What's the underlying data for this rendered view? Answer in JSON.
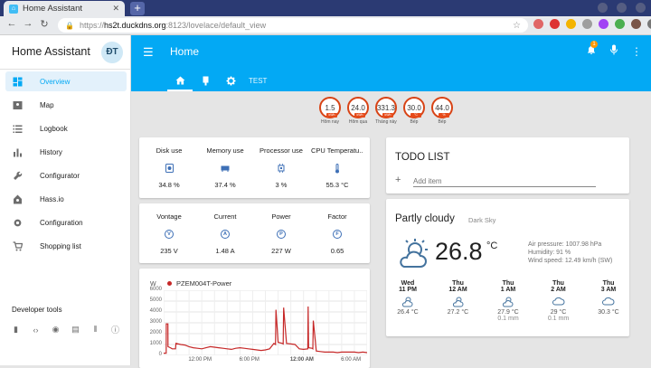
{
  "browser": {
    "tab_title": "Home Assistant",
    "url_scheme": "https://",
    "url_host": "hs2t.duckdns.org",
    "url_path": ":8123/lovelace/default_view"
  },
  "sidebar": {
    "title": "Home Assistant",
    "avatar": "ĐT",
    "items": [
      {
        "label": "Overview",
        "icon": "view-dashboard-icon",
        "active": true
      },
      {
        "label": "Map",
        "icon": "map-icon"
      },
      {
        "label": "Logbook",
        "icon": "list-icon"
      },
      {
        "label": "History",
        "icon": "chart-bar-icon"
      },
      {
        "label": "Configurator",
        "icon": "wrench-icon"
      },
      {
        "label": "Hass.io",
        "icon": "hassio-icon"
      },
      {
        "label": "Configuration",
        "icon": "gear-icon"
      },
      {
        "label": "Shopping list",
        "icon": "cart-icon"
      }
    ],
    "dev_tools_label": "Developer tools"
  },
  "header": {
    "title": "Home",
    "notification_count": "1",
    "tab_text": "TEST",
    "accent": "#03a9f4"
  },
  "gauges": [
    {
      "value": "1.5",
      "unit": "kWh",
      "label": "Hôm nay"
    },
    {
      "value": "24.0",
      "unit": "kWh",
      "label": "Hôm qua"
    },
    {
      "value": "331.3",
      "unit": "kWh",
      "label": "Tháng này"
    },
    {
      "value": "30.0",
      "unit": "°C",
      "label": "Bếp"
    },
    {
      "value": "44.0",
      "unit": "%",
      "label": "Bếp"
    }
  ],
  "system_stats": [
    {
      "name": "Disk use",
      "value": "34.8 %"
    },
    {
      "name": "Memory use",
      "value": "37.4 %"
    },
    {
      "name": "Processor use",
      "value": "3 %"
    },
    {
      "name": "CPU Temperatu...",
      "value": "55.3 °C"
    }
  ],
  "power_stats": [
    {
      "name": "Vontage",
      "letter": "V",
      "value": "235 V"
    },
    {
      "name": "Current",
      "letter": "A",
      "value": "1.48 A"
    },
    {
      "name": "Power",
      "letter": "P",
      "value": "227 W"
    },
    {
      "name": "Factor",
      "letter": "F",
      "value": "0.65"
    }
  ],
  "todo": {
    "title": "TODO LIST",
    "placeholder": "Add item"
  },
  "weather": {
    "condition": "Partly cloudy",
    "source": "Dark Sky",
    "temperature": "26.8",
    "unit": "°C",
    "pressure": "Air pressure: 1007.98 hPa",
    "humidity": "Humidity: 91 %",
    "wind": "Wind speed: 12.49 km/h (SW)",
    "forecast": [
      {
        "day": "Wed",
        "time": "11 PM",
        "temp": "26.4 °C",
        "precip": "",
        "icon": "partly-cloudy-icon"
      },
      {
        "day": "Thu",
        "time": "12 AM",
        "temp": "27.2 °C",
        "precip": "",
        "icon": "partly-cloudy-icon"
      },
      {
        "day": "Thu",
        "time": "1 AM",
        "temp": "27.9 °C",
        "precip": "0.1 mm",
        "icon": "partly-cloudy-icon"
      },
      {
        "day": "Thu",
        "time": "2 AM",
        "temp": "29 °C",
        "precip": "0.1 mm",
        "icon": "cloudy-icon"
      },
      {
        "day": "Thu",
        "time": "3 AM",
        "temp": "30.3 °C",
        "precip": "",
        "icon": "cloudy-icon"
      }
    ]
  },
  "chart_data": {
    "type": "line",
    "title": "",
    "ylabel": "W",
    "series": [
      {
        "name": "PZEM004T-Power",
        "color": "#c62828",
        "x": [
          0,
          0.3,
          0.31,
          0.5,
          0.51,
          0.8,
          1.0,
          1.4,
          1.45,
          2,
          2.5,
          3,
          3.5,
          4,
          4.5,
          5,
          5.5,
          6,
          6.5,
          7,
          7.5,
          8,
          8.5,
          9,
          9.5,
          10,
          10.5,
          11,
          11.5,
          12,
          12.5,
          13,
          13.2,
          13.25,
          13.5,
          14,
          14.1,
          14.15,
          14.5,
          15,
          15.5,
          16,
          16.5,
          17,
          17.05,
          17.1,
          17.5,
          17.6,
          17.65,
          18,
          18.5,
          19,
          19.5,
          20,
          20.5,
          21,
          21.5,
          22,
          22.5,
          23,
          23.5,
          24
        ],
        "y": [
          200,
          200,
          2900,
          2900,
          800,
          700,
          600,
          600,
          1100,
          1000,
          950,
          800,
          700,
          650,
          600,
          700,
          800,
          750,
          700,
          650,
          600,
          550,
          650,
          700,
          650,
          600,
          550,
          500,
          450,
          500,
          600,
          1100,
          1000,
          4200,
          1200,
          1100,
          1050,
          4400,
          1100,
          1050,
          1000,
          600,
          550,
          600,
          4500,
          700,
          650,
          600,
          3200,
          400,
          350,
          300,
          300,
          300,
          250,
          300,
          300,
          300,
          300,
          250,
          300,
          250
        ]
      }
    ],
    "ylim": [
      0,
      6000
    ],
    "yticks": [
      "0",
      "1000",
      "2000",
      "3000",
      "4000",
      "5000",
      "6000"
    ],
    "xticks": [
      "12:00 PM",
      "6:00 PM",
      "12:00 AM",
      "6:00 AM"
    ],
    "xlim": [
      0,
      24
    ],
    "xtick_positions": [
      4.3,
      10.3,
      16.3,
      22.3
    ],
    "bold_xtick": "12:00 AM",
    "grid": true
  }
}
